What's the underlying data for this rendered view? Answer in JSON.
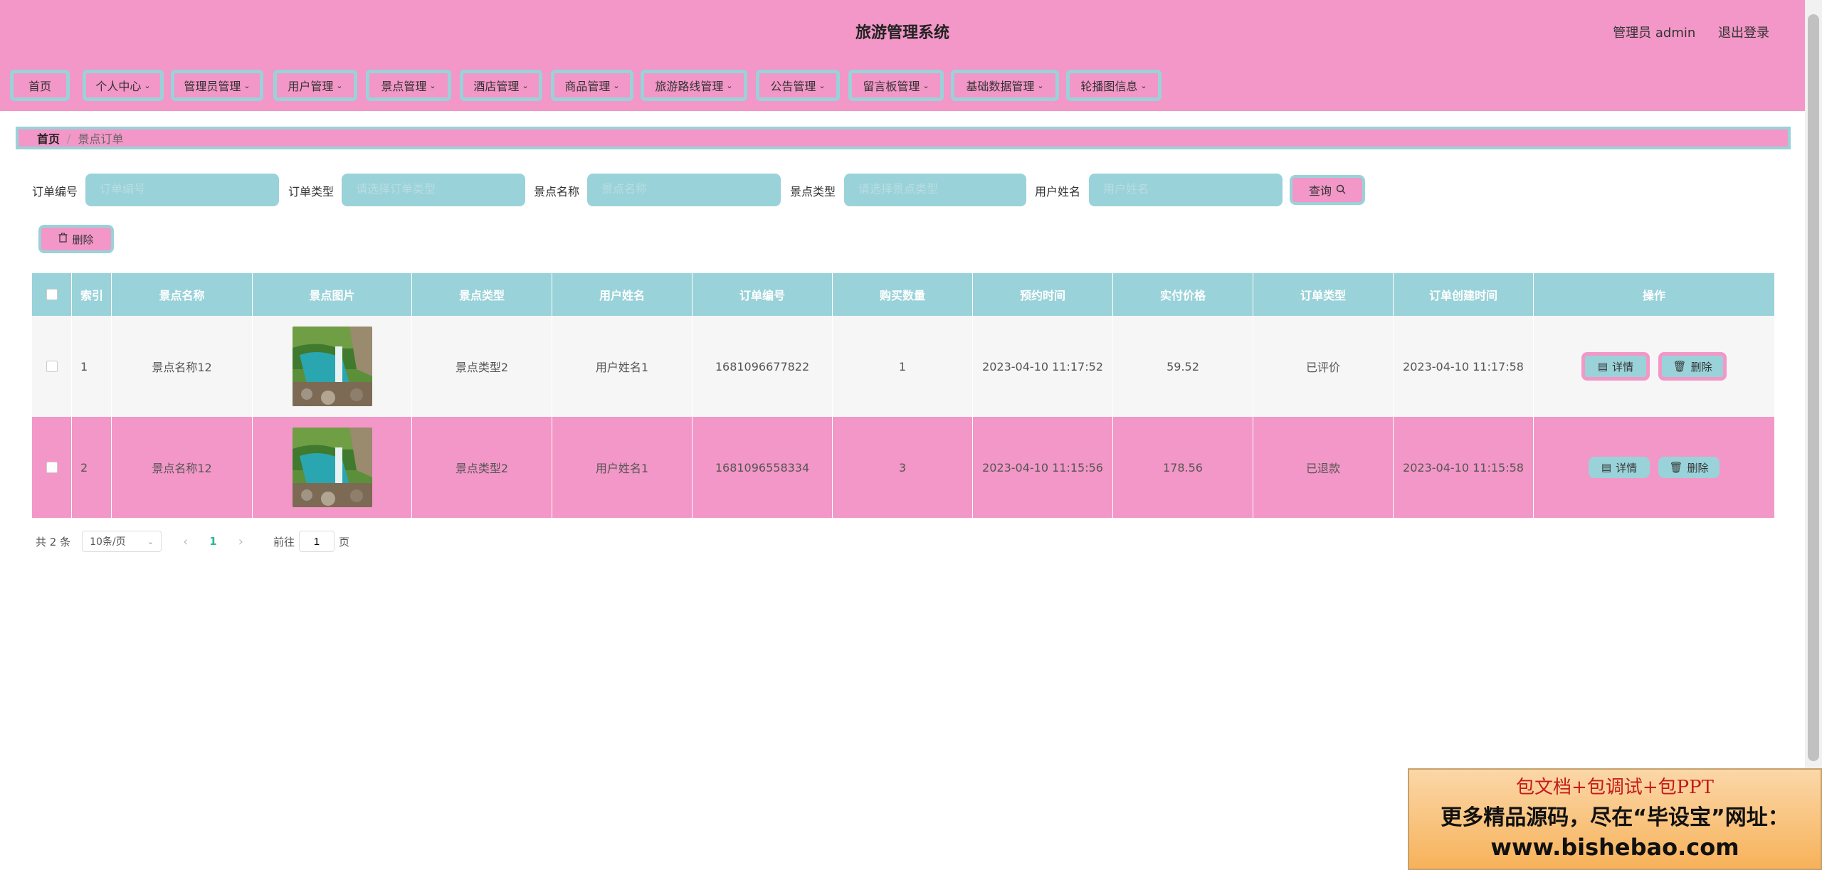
{
  "header": {
    "title": "旅游管理系统",
    "user_label": "管理员 admin",
    "logout": "退出登录"
  },
  "nav": [
    {
      "label": "首页",
      "dropdown": false
    },
    {
      "label": "个人中心",
      "dropdown": true
    },
    {
      "label": "管理员管理",
      "dropdown": true
    },
    {
      "label": "用户管理",
      "dropdown": true
    },
    {
      "label": "景点管理",
      "dropdown": true
    },
    {
      "label": "酒店管理",
      "dropdown": true
    },
    {
      "label": "商品管理",
      "dropdown": true
    },
    {
      "label": "旅游路线管理",
      "dropdown": true
    },
    {
      "label": "公告管理",
      "dropdown": true
    },
    {
      "label": "留言板管理",
      "dropdown": true
    },
    {
      "label": "基础数据管理",
      "dropdown": true
    },
    {
      "label": "轮播图信息",
      "dropdown": true
    }
  ],
  "breadcrumb": {
    "home": "首页",
    "separator": "/",
    "current": "景点订单"
  },
  "search": {
    "fields": [
      {
        "label": "订单编号",
        "placeholder": "订单编号"
      },
      {
        "label": "订单类型",
        "placeholder": "请选择订单类型"
      },
      {
        "label": "景点名称",
        "placeholder": "景点名称"
      },
      {
        "label": "景点类型",
        "placeholder": "请选择景点类型"
      },
      {
        "label": "用户姓名",
        "placeholder": "用户姓名"
      }
    ],
    "query_label": "查询"
  },
  "toolbar": {
    "delete_label": "删除"
  },
  "table": {
    "columns": [
      "索引",
      "景点名称",
      "景点图片",
      "景点类型",
      "用户姓名",
      "订单编号",
      "购买数量",
      "预约时间",
      "实付价格",
      "订单类型",
      "订单创建时间",
      "操作"
    ],
    "rows": [
      {
        "index": "1",
        "name": "景点名称12",
        "type": "景点类型2",
        "user": "用户姓名1",
        "order_no": "1681096677822",
        "qty": "1",
        "reserve_time": "2023-04-10 11:17:52",
        "price": "59.52",
        "order_type": "已评价",
        "created": "2023-04-10 11:17:58"
      },
      {
        "index": "2",
        "name": "景点名称12",
        "type": "景点类型2",
        "user": "用户姓名1",
        "order_no": "1681096558334",
        "qty": "3",
        "reserve_time": "2023-04-10 11:15:56",
        "price": "178.56",
        "order_type": "已退款",
        "created": "2023-04-10 11:15:58"
      }
    ],
    "actions": {
      "detail": "详情",
      "delete": "删除"
    }
  },
  "pager": {
    "total": "共 2 条",
    "page_size": "10条/页",
    "current": "1",
    "goto_prefix": "前往",
    "goto_value": "1",
    "goto_suffix": "页"
  },
  "ad": {
    "line1": "包文档+包调试+包PPT",
    "line2": "更多精品源码，尽在“毕设宝”网址：",
    "line3": "www.bishebao.com"
  },
  "colors": {
    "pink": "#f297c7",
    "teal": "#9ad2d9",
    "active_page": "#2bb59a"
  }
}
